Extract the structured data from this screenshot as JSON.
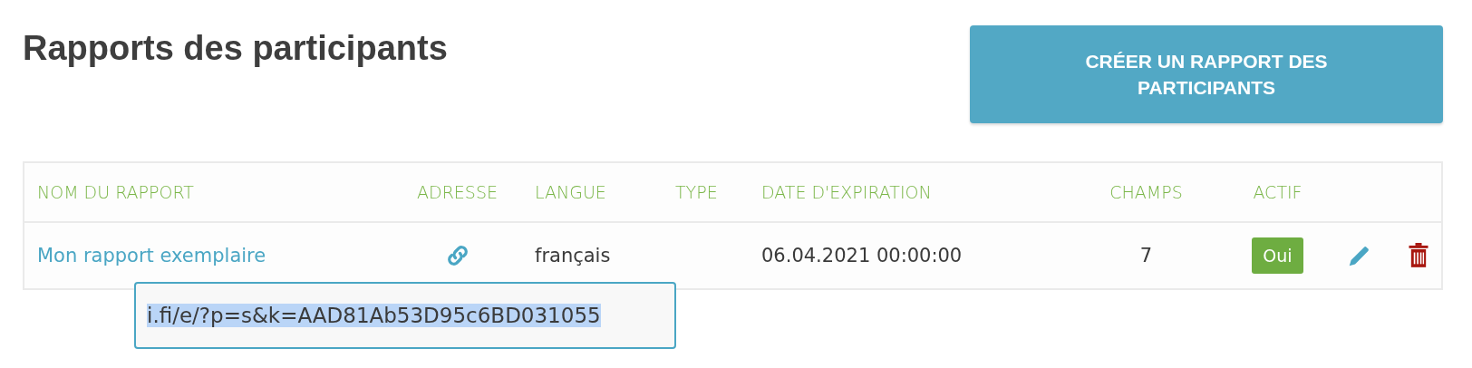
{
  "title": "Rapports des participants",
  "create_button": "CRÉER UN RAPPORT DES PARTICIPANTS",
  "table": {
    "columns": [
      "NOM DU RAPPORT",
      "ADRESSE",
      "LANGUE",
      "TYPE",
      "DATE D'EXPIRATION",
      "CHAMPS",
      "ACTIF"
    ],
    "rows": [
      {
        "name": "Mon rapport exemplaire",
        "language": "français",
        "type_value": null,
        "expiration": "06.04.2021 00:00:00",
        "fields": "7",
        "active": {
          "label": "Oui",
          "on": true
        }
      }
    ]
  },
  "address_popover": {
    "value": "i.fi/e/?p=s&k=AAD81Ab53D95c6BD031055",
    "text_selected": true
  }
}
